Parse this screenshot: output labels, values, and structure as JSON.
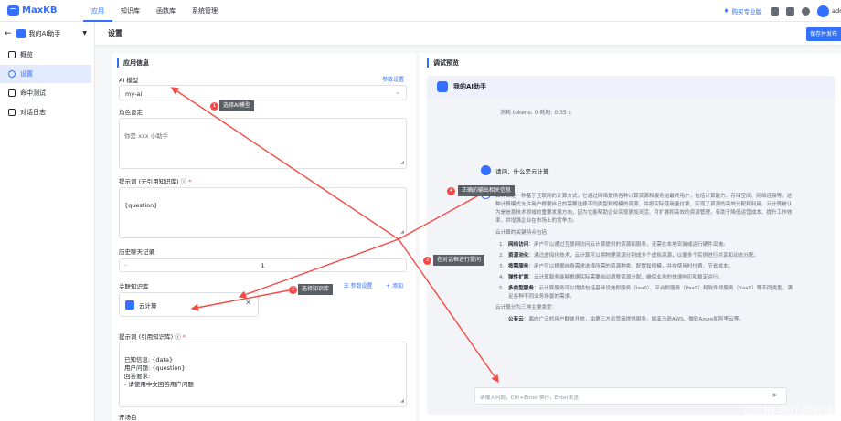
{
  "topbar": {
    "logo": "MaxKB",
    "nav": [
      "应用",
      "知识库",
      "函数库",
      "系统管理"
    ],
    "upgrade": "购买专业版",
    "user": "admin"
  },
  "sidebar": {
    "app_name": "我的AI助手",
    "items": [
      "概览",
      "设置",
      "命中测试",
      "对话日志"
    ]
  },
  "page": {
    "title": "设置",
    "save_button": "保存并发布"
  },
  "form": {
    "section": "应用信息",
    "model_label": "AI 模型",
    "param_link": "参数设置",
    "model_value": "my-ai",
    "role_label": "角色设定",
    "role_value": "你是 xxx 小助手",
    "prompt_label": "提示词 (无引用知识库)",
    "prompt_value": "{question}",
    "history_label": "历史聊天记录",
    "history_value": "1",
    "kb_label": "关联知识库",
    "kb_param_link": "参数设置",
    "kb_add_link": "添加",
    "kb_item": "云计算",
    "prompt2_label": "提示词 (引用知识库)",
    "prompt2_value": "已知信息: {data}\n用户问题: {question}\n回答要求:\n - 请使用中文回答用户问题",
    "opening_label": "开场白"
  },
  "preview": {
    "title": "调试预览",
    "assistant_name": "我的AI助手",
    "token_info": "消耗 tokens: 0   耗时: 0.35 s",
    "question": "请问，什么是云计算",
    "answer_intro": "云计算是一种基于互联网的计算方式，它通过网络提供各种计算资源和服务给最终用户，包括计算能力、存储空间、网络连接等。这种计算模式允许用户根据自己的需要选择不同类型和规模的资源，并按实际使用量付费，实现了资源的高效分配和利用。云计算被认为是信息技术领域的重要发展方向，因为它能帮助企业实现更加灵活、可扩展和高效的资源管理，有助于降低运营成本、提升工作效率，并增强企业在市场上的竞争力。",
    "answer_sub": "云计算的关键特点包括：",
    "features": [
      {
        "n": "1.",
        "name": "网络访问",
        "text": "：用户可以通过互联网访问云计算提供的资源和服务，无需在本地安装或运行硬件设施。"
      },
      {
        "n": "2.",
        "name": "资源池化",
        "text": "：通过虚拟化技术，云计算可以将物理资源分割成多个虚拟资源，以便多个实例进行共享和动态分配。"
      },
      {
        "n": "3.",
        "name": "按需服务",
        "text": "：用户可以根据自身需求选择所需的资源种类、配置和规模，并在使用时付费，节省成本。"
      },
      {
        "n": "4.",
        "name": "弹性扩展",
        "text": "：云计算服务能够根据实际需要自动调整资源分配，确保业务的快速响应和稳定运行。"
      },
      {
        "n": "5.",
        "name": "多类型服务",
        "text": "：云计算服务可以提供包括基础设施即服务（IaaS）、平台即服务（PaaS）和软件即服务（SaaS）等不同类型，满足各种不同业务场景的需求。"
      }
    ],
    "answer_types": "云计算分为三种主要类型：",
    "public_cloud_name": "公有云",
    "public_cloud_text": "：面向广泛的用户群体开放，由第三方运营商提供服务，如亚马逊AWS、微软Azure和阿里云等。",
    "input_placeholder": "请输入问题，Ctrl+Enter 换行，Enter发送"
  },
  "annotations": [
    {
      "n": "1",
      "text": "选择AI模型"
    },
    {
      "n": "2",
      "text": "选择知识库"
    },
    {
      "n": "3",
      "text": "在对话框进行提问"
    },
    {
      "n": "4",
      "text": "正确的输出相关信息"
    }
  ],
  "watermark": "CSDN @江湖有缘",
  "colors": {
    "accent": "#3370ff",
    "annotation_red": "#f54a45"
  }
}
